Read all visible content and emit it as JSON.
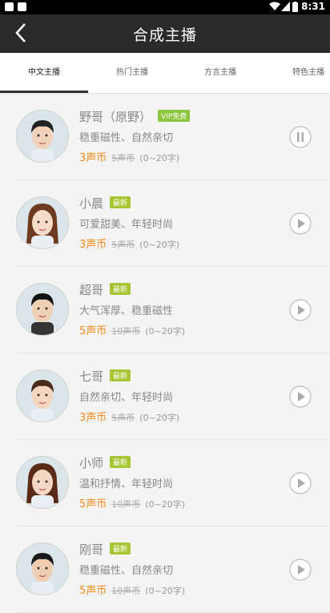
{
  "status": {
    "time": "8:31"
  },
  "header": {
    "title": "合成主播"
  },
  "tabs": [
    {
      "label": "中文主播"
    },
    {
      "label": "热门主播"
    },
    {
      "label": "方言主播"
    },
    {
      "label": "特色主播"
    }
  ],
  "anchors": [
    {
      "name": "野哥（原野）",
      "badge": "VIP免费",
      "badge_type": "vip",
      "desc": "稳重磁性、自然亲切",
      "price": "3声币",
      "old_price": "5声币",
      "range": "(0~20字)",
      "state": "pause"
    },
    {
      "name": "小晨",
      "badge": "最新",
      "badge_type": "new",
      "desc": "可爱甜美、年轻时尚",
      "price": "3声币",
      "old_price": "5声币",
      "range": "(0~20字)",
      "state": "play"
    },
    {
      "name": "超哥",
      "badge": "最新",
      "badge_type": "new",
      "desc": "大气浑厚、稳重磁性",
      "price": "5声币",
      "old_price": "10声币",
      "range": "(0~20字)",
      "state": "play"
    },
    {
      "name": "七哥",
      "badge": "最新",
      "badge_type": "new",
      "desc": "自然亲切、年轻时尚",
      "price": "3声币",
      "old_price": "5声币",
      "range": "(0~20字)",
      "state": "play"
    },
    {
      "name": "小师",
      "badge": "最新",
      "badge_type": "new",
      "desc": "温和抒情、年轻时尚",
      "price": "5声币",
      "old_price": "10声币",
      "range": "(0~20字)",
      "state": "play"
    },
    {
      "name": "刚哥",
      "badge": "最新",
      "badge_type": "new",
      "desc": "稳重磁性、自然亲切",
      "price": "5声币",
      "old_price": "10声币",
      "range": "(0~20字)",
      "state": "play"
    }
  ]
}
